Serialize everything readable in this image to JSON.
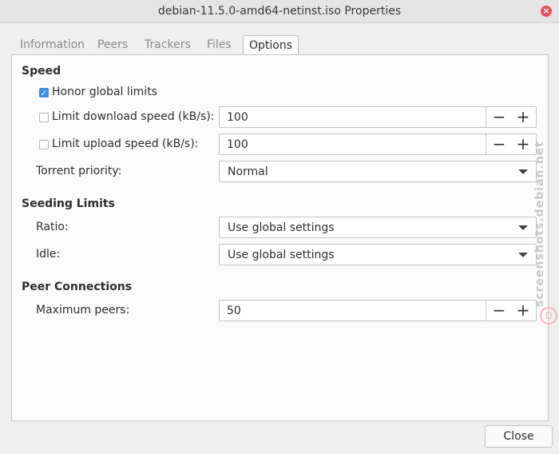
{
  "window": {
    "title": "debian-11.5.0-amd64-netinst.iso Properties"
  },
  "tabs": [
    {
      "label": "Information"
    },
    {
      "label": "Peers"
    },
    {
      "label": "Trackers"
    },
    {
      "label": "Files"
    },
    {
      "label": "Options"
    }
  ],
  "speed": {
    "title": "Speed",
    "honor_label": "Honor global limits",
    "honor_checked": true,
    "download_label": "Limit download speed (kB/s):",
    "download_checked": false,
    "download_value": "100",
    "upload_label": "Limit upload speed (kB/s):",
    "upload_checked": false,
    "upload_value": "100",
    "priority_label": "Torrent priority:",
    "priority_value": "Normal"
  },
  "seeding": {
    "title": "Seeding Limits",
    "ratio_label": "Ratio:",
    "ratio_value": "Use global settings",
    "idle_label": "Idle:",
    "idle_value": "Use global settings"
  },
  "peers": {
    "title": "Peer Connections",
    "max_label": "Maximum peers:",
    "max_value": "50"
  },
  "buttons": {
    "close_label": "Close"
  },
  "watermark": "screenshots.debian.net",
  "colors": {
    "accent": "#3d8ee8",
    "close_icon": "#e8505b"
  }
}
